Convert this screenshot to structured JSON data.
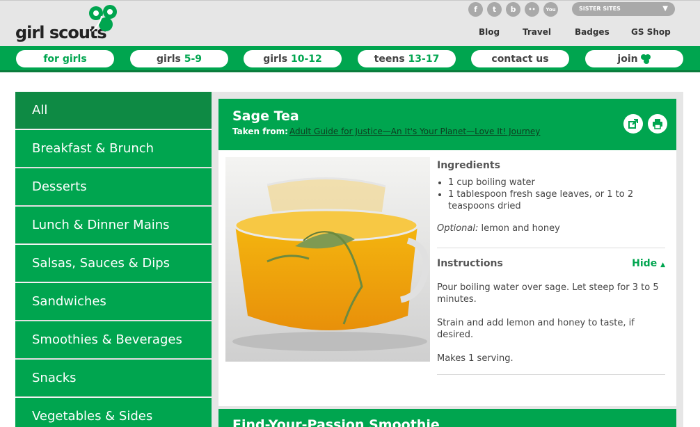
{
  "header": {
    "logo_text": "girl scouts",
    "social_icons": [
      {
        "icon": "facebook-icon",
        "glyph": "f"
      },
      {
        "icon": "twitter-icon",
        "glyph": "t"
      },
      {
        "icon": "blog-icon",
        "glyph": "b"
      },
      {
        "icon": "flickr-icon",
        "glyph": "••"
      },
      {
        "icon": "youtube-icon",
        "glyph": "You"
      }
    ],
    "sister_sites": "SISTER SITES",
    "top_links": [
      "Blog",
      "Travel",
      "Badges",
      "GS Shop"
    ]
  },
  "nav": {
    "for_girls": "for girls",
    "girls_5_9": {
      "word": "girls ",
      "range": "5-9"
    },
    "girls_10_12": {
      "word": "girls ",
      "range": "10-12"
    },
    "teens_13_17": {
      "word": "teens ",
      "range": "13-17"
    },
    "contact_us": "contact us",
    "join": "join"
  },
  "sidebar": {
    "items": [
      "All",
      "Breakfast & Brunch",
      "Desserts",
      "Lunch & Dinner Mains",
      "Salsas, Sauces & Dips",
      "Sandwiches",
      "Smoothies & Beverages",
      "Snacks",
      "Vegetables & Sides"
    ]
  },
  "recipe": {
    "title": "Sage Tea",
    "taken_from_label": "Taken from:",
    "taken_from_link": "Adult Guide for Justice—An It's Your Planet—Love It! Journey",
    "ingredients_heading": "Ingredients",
    "ingredients": [
      "1 cup boiling water",
      "1 tablespoon fresh sage leaves, or 1 to 2 teaspoons dried"
    ],
    "optional_label": "Optional:",
    "optional_text": " lemon and honey",
    "instructions_heading": "Instructions",
    "hide_label": "Hide",
    "instructions": [
      "Pour boiling water over sage. Let steep for 3 to 5 minutes.",
      "Strain and add lemon and honey to taste, if desired.",
      "Makes 1 serving."
    ]
  },
  "next_recipe": {
    "title": "Find-Your-Passion Smoothie"
  },
  "colors": {
    "brand_green": "#00a54f",
    "dark_green": "#0e8a44",
    "header_gray": "#e6e6e6"
  }
}
